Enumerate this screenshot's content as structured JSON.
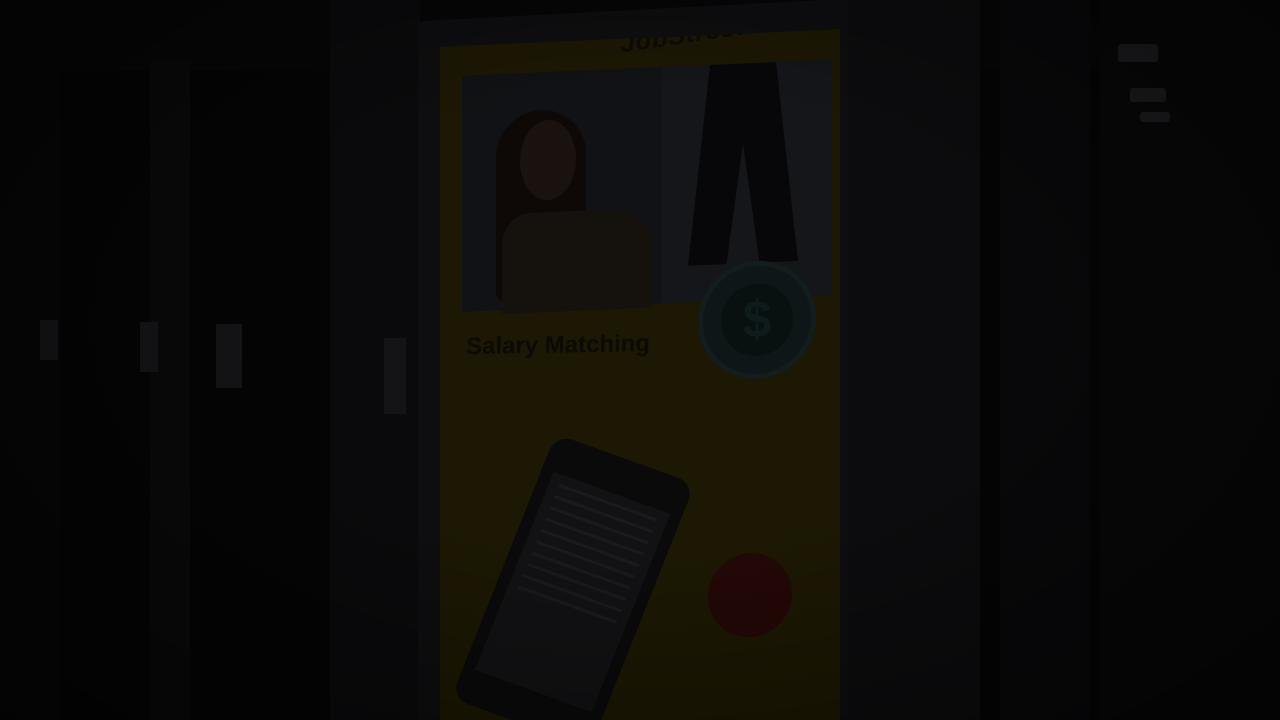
{
  "scene": {
    "description_kind": "dark photo of a subway station advertisement poster"
  },
  "poster": {
    "brand": "JobStreet.com",
    "headline": "Salary Matching",
    "colors": {
      "poster_yellow": "#1c1803",
      "badge_teal": "#0d1717",
      "badge_red": "#230807"
    },
    "icons": [
      "dollar-icon"
    ],
    "dollar_symbol": "$"
  }
}
